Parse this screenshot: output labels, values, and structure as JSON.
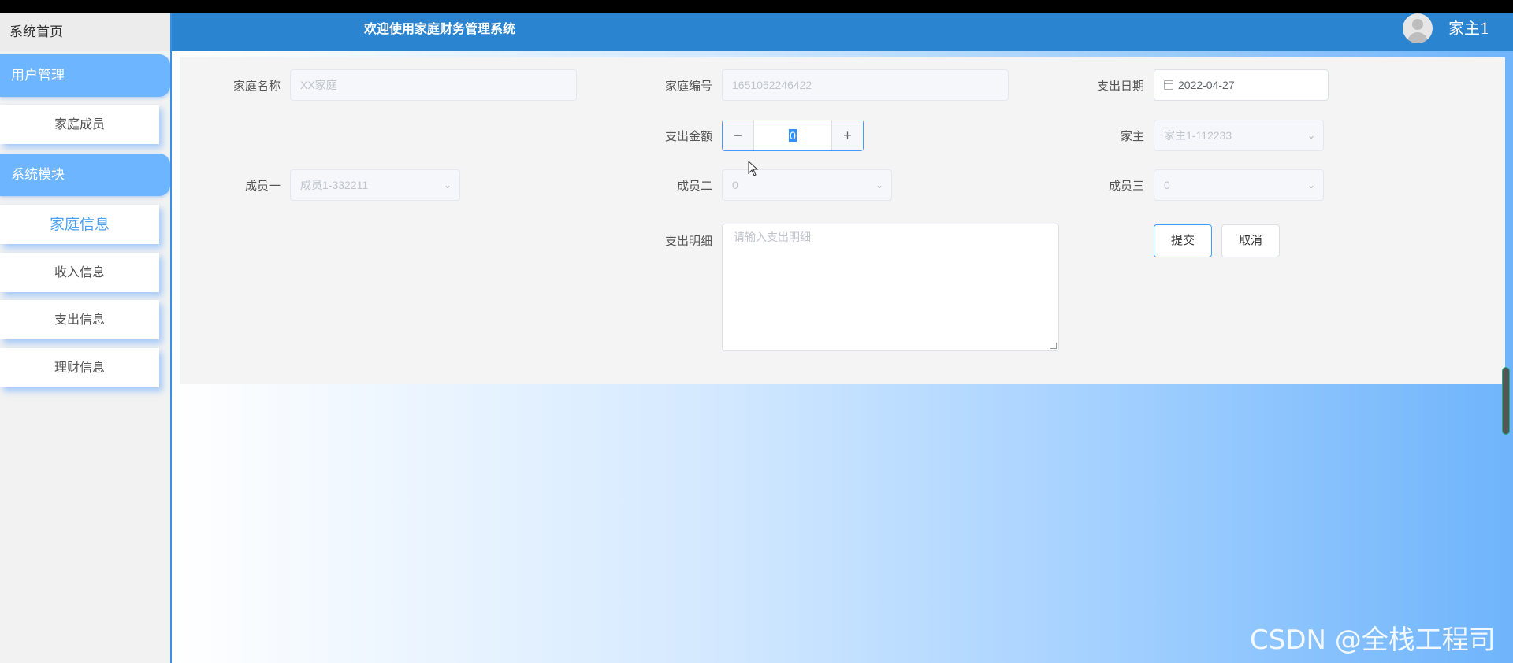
{
  "header": {
    "welcome": "欢迎使用家庭财务管理系统",
    "username": "家主1"
  },
  "sidebar": {
    "home": "系统首页",
    "groups": [
      {
        "label": "用户管理",
        "items": [
          {
            "label": "家庭成员"
          }
        ]
      },
      {
        "label": "系统模块",
        "items": [
          {
            "label": "家庭信息"
          },
          {
            "label": "收入信息"
          },
          {
            "label": "支出信息"
          },
          {
            "label": "理财信息"
          }
        ]
      }
    ]
  },
  "form": {
    "family_name": {
      "label": "家庭名称",
      "placeholder": "XX家庭"
    },
    "family_no": {
      "label": "家庭编号",
      "placeholder": "1651052246422"
    },
    "date": {
      "label": "支出日期",
      "value": "2022-04-27"
    },
    "amount": {
      "label": "支出金额",
      "value": "0",
      "minus": "−",
      "plus": "+"
    },
    "head": {
      "label": "家主",
      "value": "家主1-112233"
    },
    "member1": {
      "label": "成员一",
      "value": "成员1-332211"
    },
    "member2": {
      "label": "成员二",
      "value": "0"
    },
    "member3": {
      "label": "成员三",
      "value": "0"
    },
    "detail": {
      "label": "支出明细",
      "placeholder": "请输入支出明细"
    },
    "submit": "提交",
    "cancel": "取消"
  },
  "watermark": "CSDN @全栈工程司",
  "icons": {
    "chevron": "chevron-down-icon",
    "calendar": "calendar-icon",
    "avatar": "user-avatar-icon"
  }
}
